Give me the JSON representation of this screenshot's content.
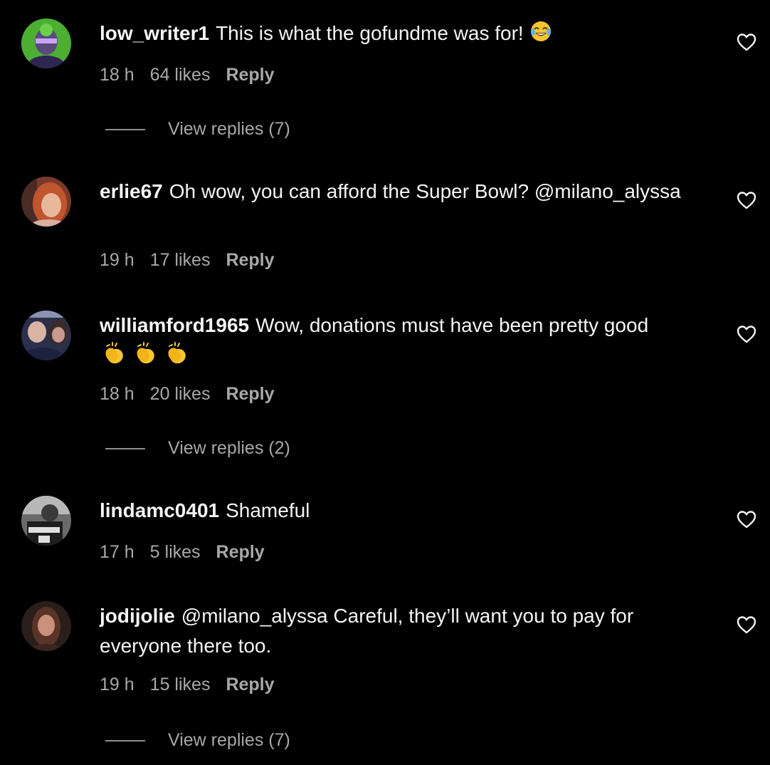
{
  "comments": [
    {
      "username": "low_writer1",
      "text": "This is what the gofundme was for!",
      "emoji": "tears-of-joy-emoji",
      "time": "18 h",
      "likes": "64 likes",
      "reply_label": "Reply",
      "view_replies": "View replies (7)",
      "like_icon": "heart-outline-icon"
    },
    {
      "username": "erlie67",
      "text": "Oh wow, you can afford the Super Bowl? @milano_alyssa",
      "time": "19 h",
      "likes": "17 likes",
      "reply_label": "Reply",
      "like_icon": "heart-outline-icon"
    },
    {
      "username": "williamford1965",
      "text": "Wow, donations must have been pretty good",
      "emoji": "clapping-hands-emoji x3",
      "time": "18 h",
      "likes": "20 likes",
      "reply_label": "Reply",
      "view_replies": "View replies (2)",
      "like_icon": "heart-outline-icon"
    },
    {
      "username": "lindamc0401",
      "text": "Shameful",
      "time": "17 h",
      "likes": "5 likes",
      "reply_label": "Reply",
      "like_icon": "heart-outline-icon"
    },
    {
      "username": "jodijolie",
      "text": "@milano_alyssa Careful, they’ll want you to pay for everyone there too.",
      "time": "19 h",
      "likes": "15 likes",
      "reply_label": "Reply",
      "view_replies": "View replies (7)",
      "like_icon": "heart-outline-icon"
    }
  ],
  "colors": {
    "background": "#000000",
    "primary_text": "#f5f5f5",
    "secondary_text": "#a8a8a8",
    "divider": "#8e8e8e"
  }
}
